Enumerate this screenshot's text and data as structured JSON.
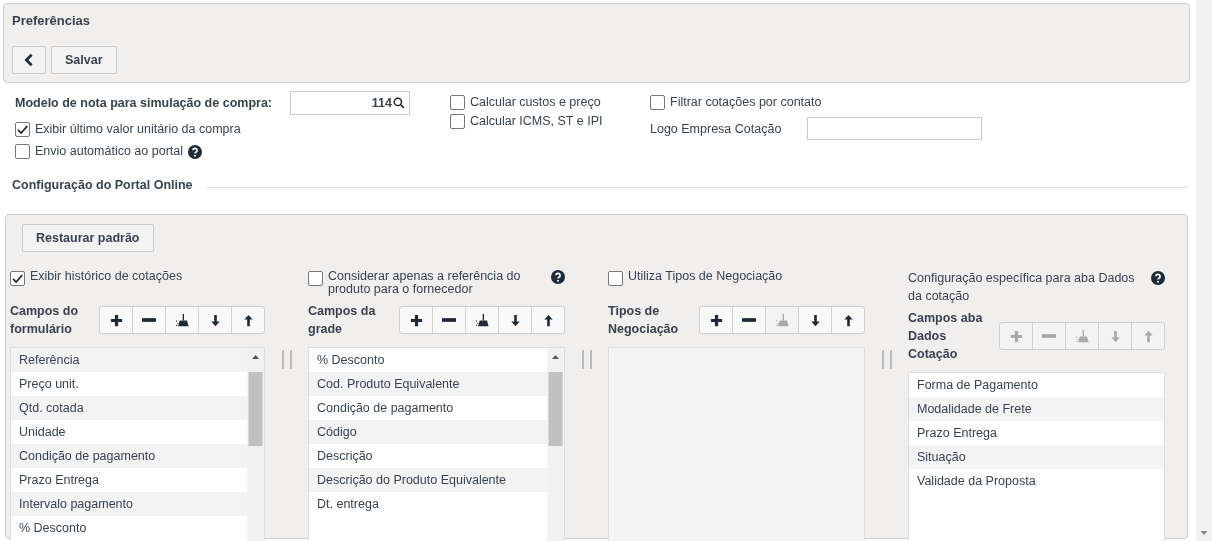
{
  "header": {
    "title": "Preferências",
    "buttons": [
      {
        "kind": "back"
      },
      {
        "kind": "label",
        "label": "Salvar"
      }
    ]
  },
  "form": {
    "model_label": "Modelo de nota para simulação de compra:",
    "model_value": "114",
    "left_options": [
      {
        "label": "Exibir último valor unitário da compra",
        "checked": true,
        "help": false
      },
      {
        "label": "Envio automático ao portal",
        "checked": false,
        "help": true
      }
    ],
    "middle_options": [
      {
        "label": "Calcular custos e preço",
        "checked": false,
        "help": false
      },
      {
        "label": "Calcular ICMS, ST e IPI",
        "checked": false,
        "help": false
      }
    ],
    "right_options": [
      {
        "label": "Filtrar cotações por contato",
        "checked": false,
        "help": false
      }
    ],
    "logo_label": "Logo Empresa Cotação"
  },
  "section_title": "Configuração do Portal Online",
  "portal": {
    "restore_button": "Restaurar padrão",
    "columns": [
      {
        "option": {
          "kind": "checkbox",
          "label": "Exibir histórico de cotações",
          "checked": true,
          "help": false
        },
        "fields_label": "Campos do formulário",
        "tools": [
          {
            "kind": "add",
            "disabled": false
          },
          {
            "kind": "remove",
            "disabled": false
          },
          {
            "kind": "clear",
            "disabled": false
          },
          {
            "kind": "down",
            "disabled": false
          },
          {
            "kind": "up",
            "disabled": false
          }
        ],
        "list_disabled": false,
        "scrollable": true,
        "first_row_shaded": true,
        "items": [
          "Referência",
          "Preço unit.",
          "Qtd. cotada",
          "Unidade",
          "Condição de pagamento",
          "Prazo Entrega",
          "Intervalo pagamento",
          "% Desconto"
        ]
      },
      {
        "option": {
          "kind": "checkbox",
          "label": "Considerar apenas a referência do produto para o fornecedor",
          "checked": false,
          "help": true
        },
        "fields_label": "Campos da grade",
        "tools": [
          {
            "kind": "add",
            "disabled": false
          },
          {
            "kind": "remove",
            "disabled": false
          },
          {
            "kind": "clear",
            "disabled": false
          },
          {
            "kind": "down",
            "disabled": false
          },
          {
            "kind": "up",
            "disabled": false
          }
        ],
        "list_disabled": false,
        "scrollable": true,
        "first_row_shaded": false,
        "items": [
          "% Desconto",
          "Cod. Produto Equivalente",
          "Condição de pagamento",
          "Código",
          "Descrição",
          "Descrição do Produto Equivalente",
          "Dt. entrega"
        ]
      },
      {
        "option": {
          "kind": "checkbox",
          "label": "Utiliza Tipos de Negociação",
          "checked": false,
          "help": false
        },
        "fields_label": "Tipos de Negociação",
        "tools": [
          {
            "kind": "add",
            "disabled": false
          },
          {
            "kind": "remove",
            "disabled": false
          },
          {
            "kind": "clear",
            "disabled": true
          },
          {
            "kind": "down",
            "disabled": false
          },
          {
            "kind": "up",
            "disabled": false
          }
        ],
        "list_disabled": true,
        "scrollable": false
      },
      {
        "option": {
          "kind": "text",
          "label": "Configuração específica para aba Dados da cotação",
          "help": true
        },
        "fields_label": "Campos aba Dados Cotação",
        "tools": [
          {
            "kind": "add",
            "disabled": true
          },
          {
            "kind": "remove",
            "disabled": true
          },
          {
            "kind": "clear",
            "disabled": true
          },
          {
            "kind": "down",
            "disabled": true
          },
          {
            "kind": "up",
            "disabled": true
          }
        ],
        "list_disabled": false,
        "scrollable": false,
        "first_row_shaded": false,
        "items": [
          "Forma de Pagamento",
          "Modalidade de Frete",
          "Prazo Entrega",
          "Situação",
          "Validade da Proposta"
        ]
      }
    ]
  }
}
